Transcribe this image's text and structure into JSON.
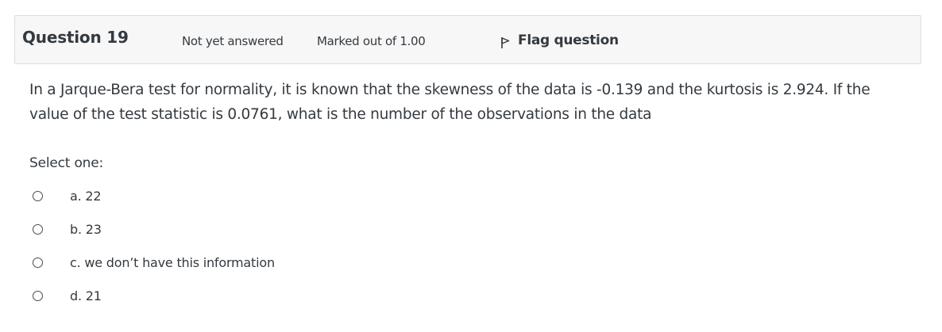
{
  "info": {
    "question_label": "Question 19",
    "state": "Not yet answered",
    "grade": "Marked out of 1.00",
    "flag_label": "Flag question",
    "flag_icon": "flag-icon"
  },
  "question": {
    "text": "In a Jarque-Bera test for normality, it is known that the skewness of the data is -0.139 and the kurtosis is 2.924. If the value of the test statistic is 0.0761, what is the number of the observations in the data"
  },
  "answer": {
    "prompt": "Select one:",
    "options": [
      {
        "label": "a. 22",
        "selected": false
      },
      {
        "label": "b. 23",
        "selected": false
      },
      {
        "label": "c. we don’t have this information",
        "selected": false
      },
      {
        "label": "d. 21",
        "selected": false
      }
    ]
  }
}
